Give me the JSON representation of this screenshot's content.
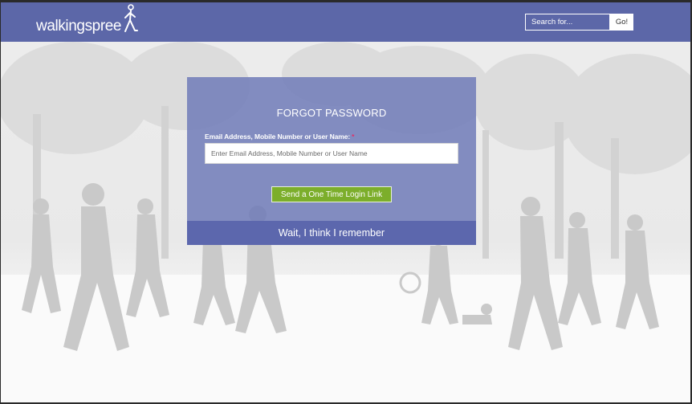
{
  "header": {
    "logo_text": "walkingspree",
    "search": {
      "placeholder": "Search for...",
      "button_label": "Go!"
    }
  },
  "card": {
    "title": "FORGOT PASSWORD",
    "field_label": "Email Address, Mobile Number or User Name:",
    "required_marker": "*",
    "input_placeholder": "Enter Email Address, Mobile Number or User Name",
    "submit_label": "Send a One Time Login Link",
    "remember_link": "Wait, I think I remember"
  },
  "colors": {
    "header": "#5c67a8",
    "card": "#6e79b8",
    "card_footer": "#5c67ad",
    "submit": "#7cae2b",
    "required": "#e0306a"
  },
  "icons": [
    "walking-person-logo-icon"
  ]
}
